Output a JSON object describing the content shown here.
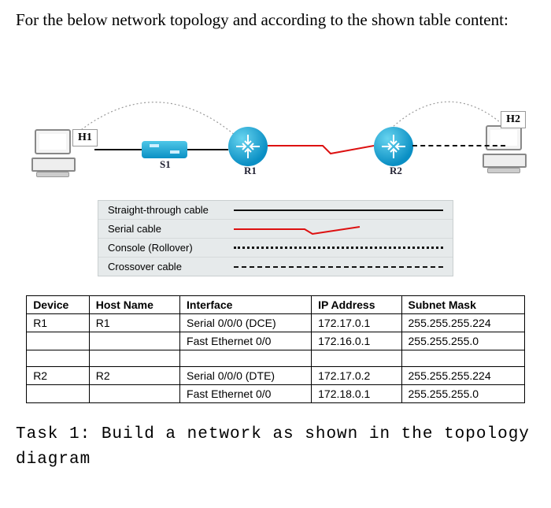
{
  "intro": "For the below network topology and according to the shown table content:",
  "labels": {
    "h1": "H1",
    "h2": "H2",
    "s1": "S1",
    "r1": "R1",
    "r2": "R2"
  },
  "legend": [
    {
      "name": "Straight-through cable",
      "style": "solid"
    },
    {
      "name": "Serial cable",
      "style": "serial"
    },
    {
      "name": "Console (Rollover)",
      "style": "dotted"
    },
    {
      "name": "Crossover cable",
      "style": "dashed"
    }
  ],
  "table": {
    "headers": [
      "Device",
      "Host Name",
      "Interface",
      "IP Address",
      "Subnet Mask"
    ],
    "groups": [
      {
        "device": "R1",
        "host": "R1",
        "rows": [
          {
            "interface": "Serial 0/0/0 (DCE)",
            "ip": "172.17.0.1",
            "mask": "255.255.255.224"
          },
          {
            "interface": "Fast Ethernet 0/0",
            "ip": "172.16.0.1",
            "mask": "255.255.255.0"
          }
        ]
      },
      {
        "device": "R2",
        "host": "R2",
        "rows": [
          {
            "interface": "Serial 0/0/0 (DTE)",
            "ip": "172.17.0.2",
            "mask": "255.255.255.224"
          },
          {
            "interface": "Fast Ethernet 0/0",
            "ip": "172.18.0.1",
            "mask": "255.255.255.0"
          }
        ]
      }
    ]
  },
  "task": "Task 1: Build a network as shown in the topology diagram"
}
